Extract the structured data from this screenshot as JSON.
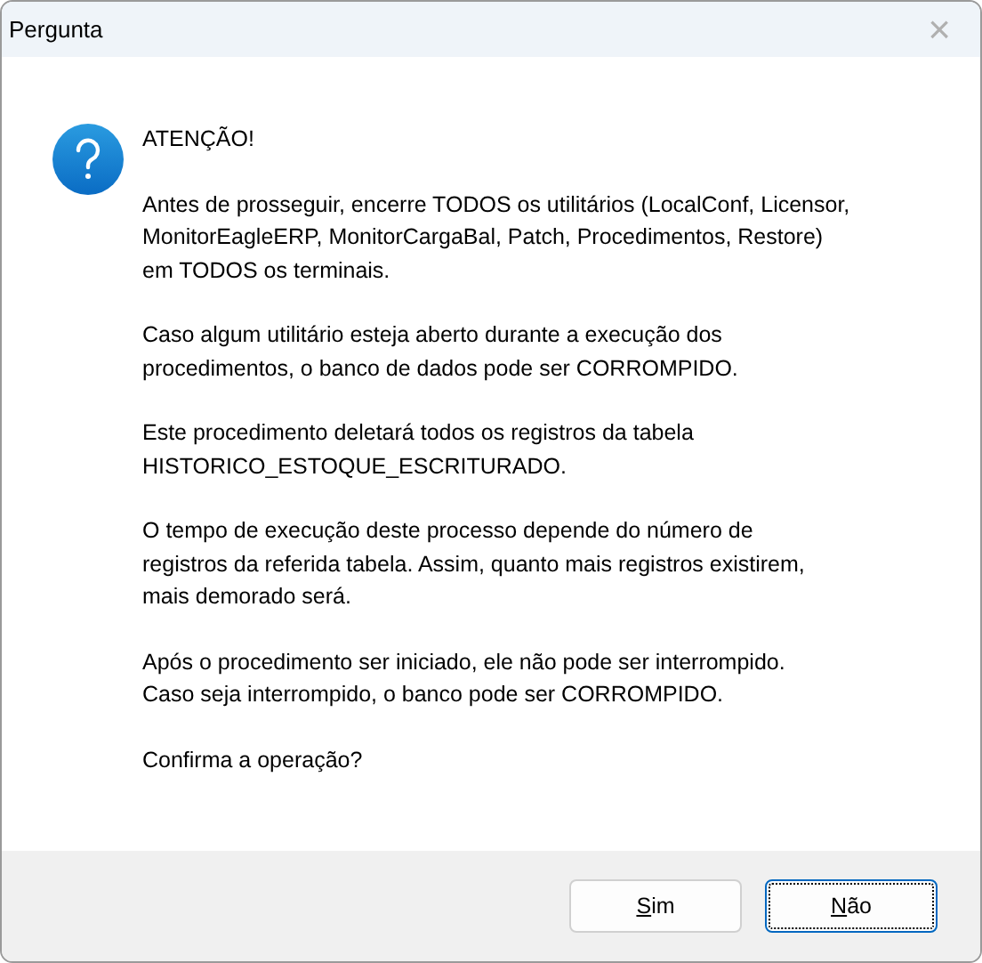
{
  "window": {
    "title": "Pergunta",
    "close": "×"
  },
  "message": {
    "paragraphs": [
      [
        "ATENÇÃO!"
      ],
      [
        "Antes de prosseguir, encerre TODOS os utilitários (LocalConf, Licensor,",
        "MonitorEagleERP, MonitorCargaBal, Patch, Procedimentos, Restore)",
        "em TODOS os terminais."
      ],
      [
        "Caso algum utilitário esteja aberto durante a execução dos",
        "procedimentos, o banco de dados pode ser CORROMPIDO."
      ],
      [
        "Este procedimento deletará todos os registros da tabela",
        "HISTORICO_ESTOQUE_ESCRITURADO."
      ],
      [
        "O tempo de execução deste processo depende do número de",
        "registros da referida tabela. Assim, quanto mais registros existirem,",
        "mais demorado será."
      ],
      [
        "Após o procedimento ser iniciado, ele não pode ser interrompido.",
        "Caso seja interrompido, o banco pode ser CORROMPIDO."
      ],
      [
        "Confirma a operação?"
      ]
    ]
  },
  "buttons": [
    {
      "mnemonic": "S",
      "rest": "im",
      "selected": false
    },
    {
      "mnemonic": "N",
      "rest": "ão",
      "selected": true
    }
  ]
}
